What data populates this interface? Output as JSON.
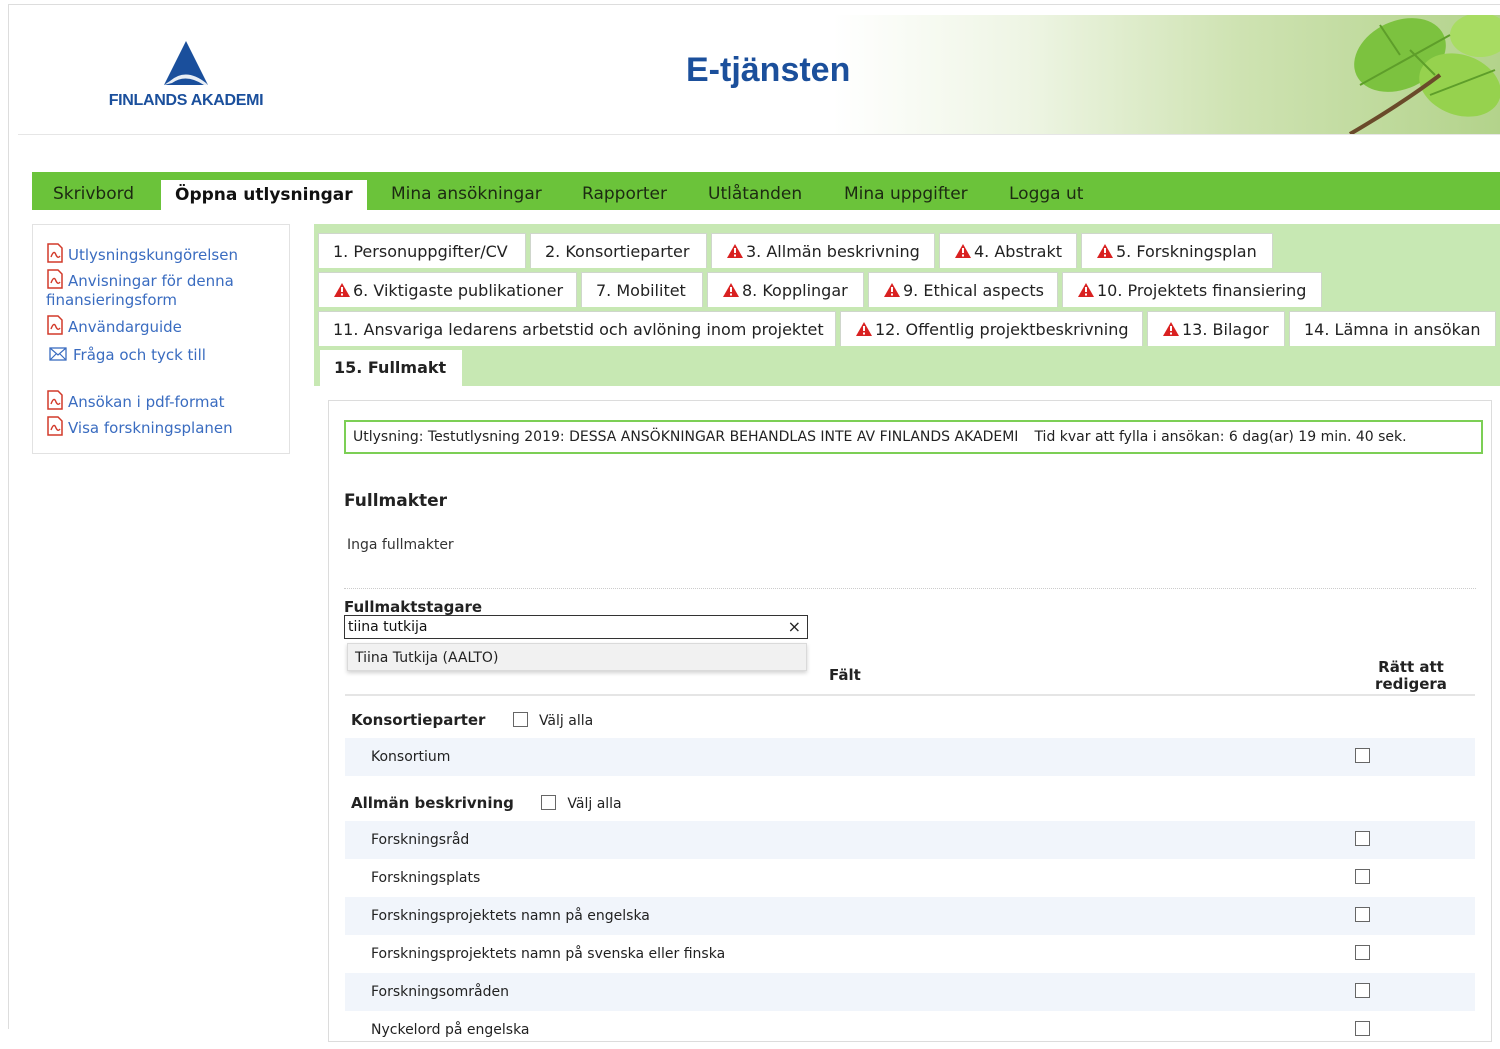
{
  "header": {
    "logo_text": "FINLANDS AKADEMI",
    "site_title": "E-tjänsten"
  },
  "nav": {
    "items": [
      "Skrivbord",
      "Öppna utlysningar",
      "Mina ansökningar",
      "Rapporter",
      "Utlåtanden",
      "Mina uppgifter",
      "Logga ut"
    ],
    "active": "Öppna utlysningar"
  },
  "sidebar": {
    "links": [
      {
        "icon": "pdf-icon",
        "label": "Utlysningskungörelsen"
      },
      {
        "icon": "pdf-icon",
        "label": "Anvisningar för denna"
      },
      {
        "icon": "pdf-icon",
        "label": "finansieringsform"
      },
      {
        "icon": "pdf-icon",
        "label": "Användarguide"
      },
      {
        "icon": "mail-icon",
        "label": "Fråga och tyck till"
      },
      {
        "icon": "pdf-icon",
        "label": "Ansökan i pdf-format"
      },
      {
        "icon": "pdf-icon",
        "label": "Visa forskningsplanen"
      }
    ]
  },
  "tabs": [
    {
      "label": "1. Personuppgifter/CV",
      "warning": false
    },
    {
      "label": "2. Konsortieparter",
      "warning": false
    },
    {
      "label": "3. Allmän beskrivning",
      "warning": true
    },
    {
      "label": "4. Abstrakt",
      "warning": true
    },
    {
      "label": "5. Forskningsplan",
      "warning": true
    },
    {
      "label": "6. Viktigaste publikationer",
      "warning": true
    },
    {
      "label": "7. Mobilitet",
      "warning": false
    },
    {
      "label": "8. Kopplingar",
      "warning": true
    },
    {
      "label": "9. Ethical aspects",
      "warning": true
    },
    {
      "label": "10. Projektets finansiering",
      "warning": true
    },
    {
      "label": "11. Ansvariga ledarens arbetstid och avlöning inom projektet",
      "warning": false
    },
    {
      "label": "12. Offentlig projektbeskrivning",
      "warning": true
    },
    {
      "label": "13. Bilagor",
      "warning": true
    },
    {
      "label": "14. Lämna in ansökan",
      "warning": false
    },
    {
      "label": "15. Fullmakt",
      "warning": false,
      "active": true
    }
  ],
  "main": {
    "info_call": "Utlysning: Testutlysning 2019: DESSA ANSÖKNINGAR BEHANDLAS INTE AV FINLANDS AKADEMI",
    "info_time": "Tid kvar att fylla i ansökan: 6 dag(ar) 19 min. 40 sek.",
    "section_title": "Fullmakter",
    "no_items": "Inga fullmakter",
    "recipient_label": "Fullmaktstagare",
    "search_value": "tiina tutkija",
    "clear_symbol": "×",
    "autocomplete_option": "Tiina Tutkija (AALTO)",
    "col_field": "Fält",
    "col_right_line1": "Rätt att",
    "col_right_line2": "redigera",
    "select_all": "Välj alla",
    "groups": [
      {
        "title": "Konsortieparter",
        "rows": [
          "Konsortium"
        ]
      },
      {
        "title": "Allmän beskrivning",
        "rows": [
          "Forskningsråd",
          "Forskningsplats",
          "Forskningsprojektets namn på engelska",
          "Forskningsprojektets namn på svenska eller finska",
          "Forskningsområden",
          "Nyckelord på engelska"
        ]
      }
    ]
  },
  "colors": {
    "nav_green": "#6bc33a",
    "tab_area": "#c7e8b3",
    "brand_blue": "#1b4f9b",
    "link_blue": "#3a6cc0",
    "warning_red": "#d92121"
  }
}
